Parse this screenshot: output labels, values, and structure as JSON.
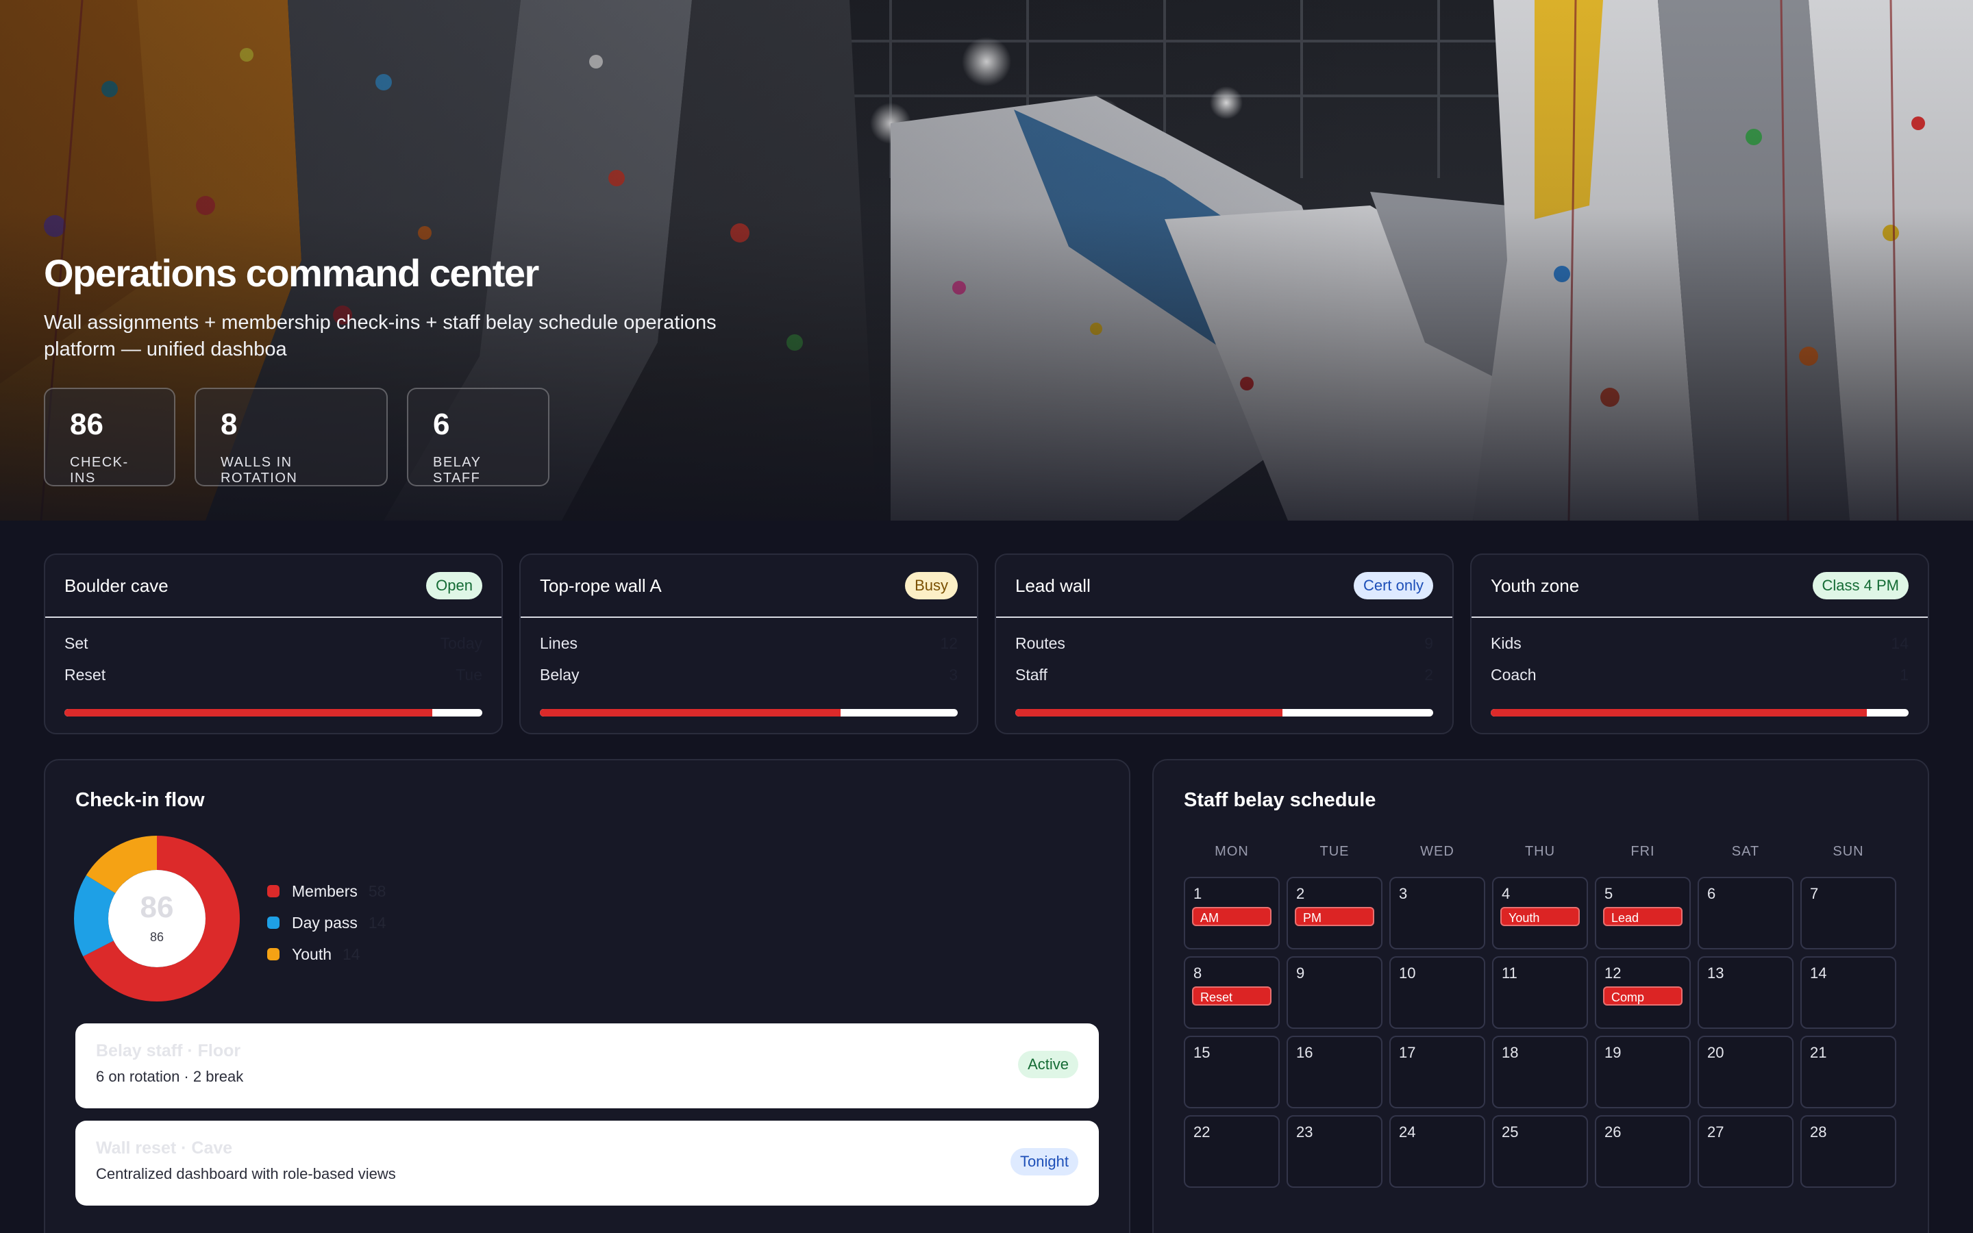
{
  "hero": {
    "title": "Operations command center",
    "subtitle": "Wall assignments + membership check-ins + staff belay schedule operations platform — unified dashboa",
    "stats": [
      {
        "value": "86",
        "label": "CHECK-INS"
      },
      {
        "value": "8",
        "label": "WALLS IN ROTATION"
      },
      {
        "value": "6",
        "label": "BELAY STAFF"
      }
    ]
  },
  "zones": [
    {
      "title": "Boulder cave",
      "badge": "Open",
      "badge_tone": "green",
      "rows": [
        {
          "label": "Set",
          "value": "Today"
        },
        {
          "label": "Reset",
          "value": "Tue"
        }
      ],
      "progress": 0.88
    },
    {
      "title": "Top-rope wall A",
      "badge": "Busy",
      "badge_tone": "yellow",
      "rows": [
        {
          "label": "Lines",
          "value": "12"
        },
        {
          "label": "Belay",
          "value": "3"
        }
      ],
      "progress": 0.72
    },
    {
      "title": "Lead wall",
      "badge": "Cert only",
      "badge_tone": "blue",
      "rows": [
        {
          "label": "Routes",
          "value": "9"
        },
        {
          "label": "Staff",
          "value": "2"
        }
      ],
      "progress": 0.64
    },
    {
      "title": "Youth zone",
      "badge": "Class 4 PM",
      "badge_tone": "green",
      "rows": [
        {
          "label": "Kids",
          "value": "14"
        },
        {
          "label": "Coach",
          "value": "1"
        }
      ],
      "progress": 0.9
    }
  ],
  "checkin": {
    "title": "Check-in flow",
    "total": "86",
    "total_label": "86",
    "legend": [
      {
        "label": "Members",
        "value": "58",
        "color": "#dc2a2a"
      },
      {
        "label": "Day pass",
        "value": "14",
        "color": "#1ea0e6"
      },
      {
        "label": "Youth",
        "value": "14",
        "color": "#f5a214"
      }
    ],
    "tickets": [
      {
        "title": "Belay staff · Floor",
        "sub": "6 on rotation · 2 break",
        "badge": "Active",
        "badge_tone": "green"
      },
      {
        "title": "Wall reset · Cave",
        "sub": "Centralized dashboard with role-based views",
        "badge": "Tonight",
        "badge_tone": "blue"
      }
    ]
  },
  "chart_data": {
    "type": "pie",
    "categories": [
      "Members",
      "Day pass",
      "Youth"
    ],
    "values": [
      58,
      14,
      14
    ],
    "colors": [
      "#dc2a2a",
      "#1ea0e6",
      "#f5a214"
    ],
    "title": "Check-in flow"
  },
  "schedule": {
    "title": "Staff belay schedule",
    "days": [
      "MON",
      "TUE",
      "WED",
      "THU",
      "FRI",
      "SAT",
      "SUN"
    ],
    "weeks": [
      [
        {
          "d": "1",
          "e": "AM"
        },
        {
          "d": "2",
          "e": "PM"
        },
        {
          "d": "3",
          "e": ""
        },
        {
          "d": "4",
          "e": "Youth"
        },
        {
          "d": "5",
          "e": "Lead"
        },
        {
          "d": "6",
          "e": ""
        },
        {
          "d": "7",
          "e": ""
        }
      ],
      [
        {
          "d": "8",
          "e": "Reset"
        },
        {
          "d": "9",
          "e": ""
        },
        {
          "d": "10",
          "e": ""
        },
        {
          "d": "11",
          "e": ""
        },
        {
          "d": "12",
          "e": "Comp"
        },
        {
          "d": "13",
          "e": ""
        },
        {
          "d": "14",
          "e": ""
        }
      ],
      [
        {
          "d": "15",
          "e": ""
        },
        {
          "d": "16",
          "e": ""
        },
        {
          "d": "17",
          "e": ""
        },
        {
          "d": "18",
          "e": ""
        },
        {
          "d": "19",
          "e": ""
        },
        {
          "d": "20",
          "e": ""
        },
        {
          "d": "21",
          "e": ""
        }
      ],
      [
        {
          "d": "22",
          "e": ""
        },
        {
          "d": "23",
          "e": ""
        },
        {
          "d": "24",
          "e": ""
        },
        {
          "d": "25",
          "e": ""
        },
        {
          "d": "26",
          "e": ""
        },
        {
          "d": "27",
          "e": ""
        },
        {
          "d": "28",
          "e": ""
        }
      ]
    ]
  }
}
